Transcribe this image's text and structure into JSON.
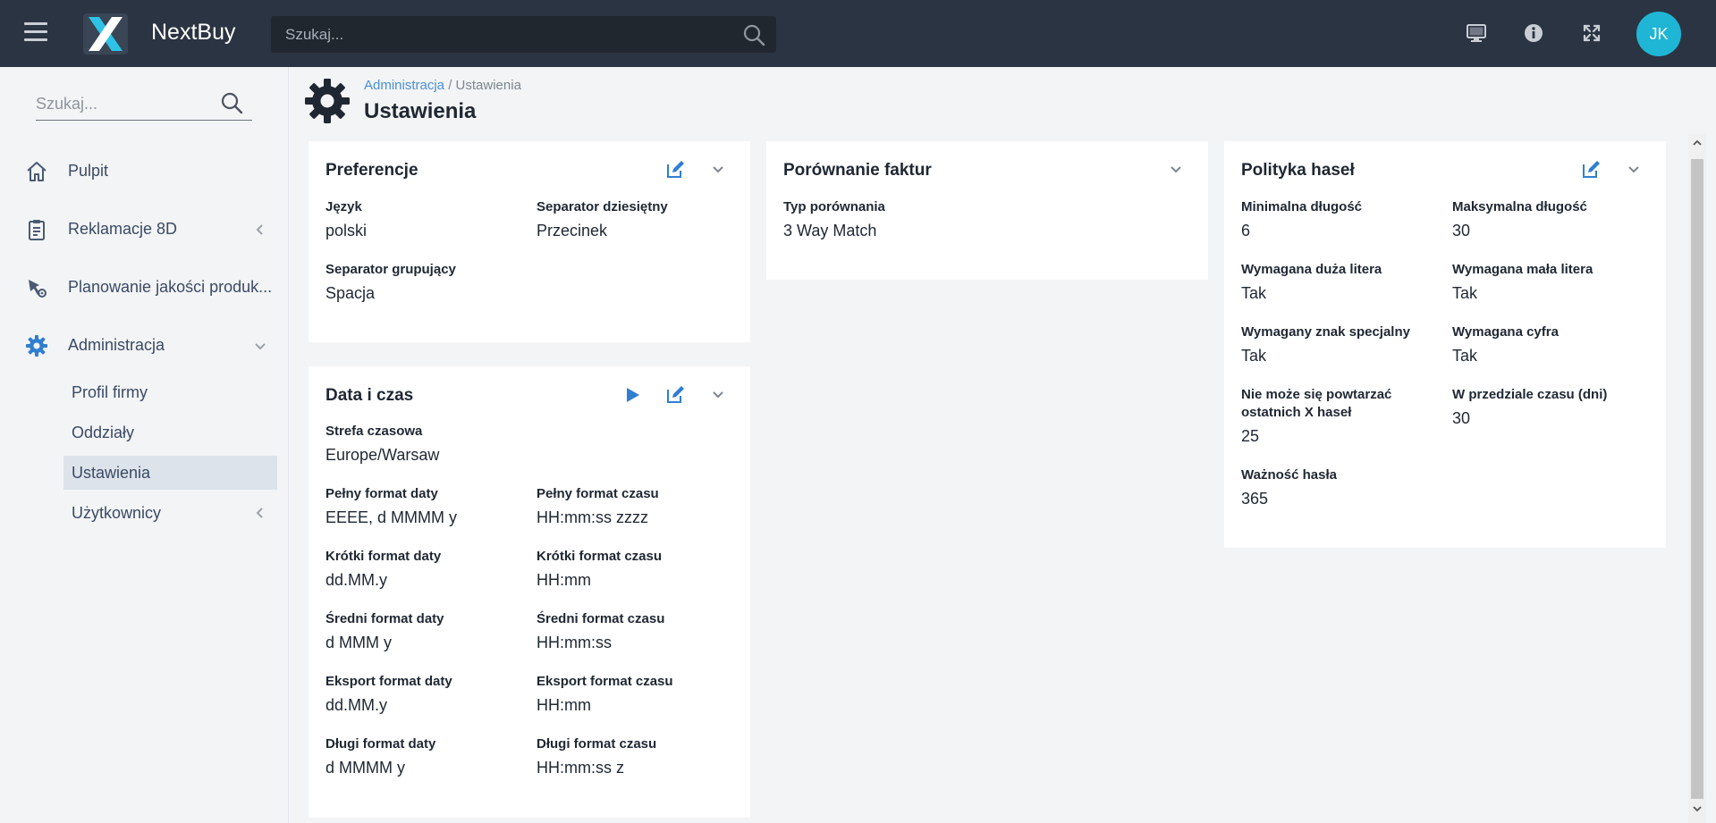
{
  "app": {
    "brand": "NextBuy",
    "search_placeholder": "Szukaj...",
    "avatar_initials": "JK"
  },
  "sidebar": {
    "search_placeholder": "Szukaj...",
    "items": [
      {
        "label": "Pulpit",
        "icon": "home-icon"
      },
      {
        "label": "Reklamacje 8D",
        "icon": "clipboard-icon"
      },
      {
        "label": "Planowanie jakości produk...",
        "icon": "quality-planning-icon"
      },
      {
        "label": "Administracja",
        "icon": "gear-icon"
      }
    ],
    "sub_items": [
      {
        "label": "Profil firmy"
      },
      {
        "label": "Oddziały"
      },
      {
        "label": "Ustawienia"
      },
      {
        "label": "Użytkownicy"
      }
    ]
  },
  "header": {
    "breadcrumb_parent": "Administracja",
    "breadcrumb_separator": "/",
    "breadcrumb_current": "Ustawienia",
    "title": "Ustawienia"
  },
  "cards": {
    "preferences": {
      "title": "Preferencje",
      "fields": [
        {
          "label": "Język",
          "value": "polski"
        },
        {
          "label": "Separator dziesiętny",
          "value": "Przecinek"
        },
        {
          "label": "Separator grupujący",
          "value": "Spacja"
        }
      ]
    },
    "datetime": {
      "title": "Data i czas",
      "fields": [
        {
          "label": "Strefa czasowa",
          "value": "Europe/Warsaw"
        },
        {
          "label": "Pełny format daty",
          "value": "EEEE, d MMMM y"
        },
        {
          "label": "Pełny format czasu",
          "value": "HH:mm:ss zzzz"
        },
        {
          "label": "Krótki format daty",
          "value": "dd.MM.y"
        },
        {
          "label": "Krótki format czasu",
          "value": "HH:mm"
        },
        {
          "label": "Średni format daty",
          "value": "d MMM y"
        },
        {
          "label": "Średni format czasu",
          "value": "HH:mm:ss"
        },
        {
          "label": "Eksport format daty",
          "value": "dd.MM.y"
        },
        {
          "label": "Eksport format czasu",
          "value": "HH:mm"
        },
        {
          "label": "Długi format daty",
          "value": "d MMMM y"
        },
        {
          "label": "Długi format czasu",
          "value": "HH:mm:ss z"
        }
      ]
    },
    "invoice": {
      "title": "Porównanie faktur",
      "fields": [
        {
          "label": "Typ porównania",
          "value": "3 Way Match"
        }
      ]
    },
    "password": {
      "title": "Polityka haseł",
      "fields": [
        {
          "label": "Minimalna długość",
          "value": "6"
        },
        {
          "label": "Maksymalna długość",
          "value": "30"
        },
        {
          "label": "Wymagana duża litera",
          "value": "Tak"
        },
        {
          "label": "Wymagana mała litera",
          "value": "Tak"
        },
        {
          "label": "Wymagany znak specjalny",
          "value": "Tak"
        },
        {
          "label": "Wymagana cyfra",
          "value": "Tak"
        },
        {
          "label": "Nie może się powtarzać ostatnich X haseł",
          "value": "25"
        },
        {
          "label": "W przedziale czasu (dni)",
          "value": "30"
        },
        {
          "label": "Ważność hasła",
          "value": "365"
        }
      ]
    }
  },
  "colors": {
    "topbar": "#2b3442",
    "accent": "#4a8fd6",
    "avatar": "#1fb6d6",
    "nav_text": "#3a4a66",
    "active_bg": "#dde3ea"
  }
}
